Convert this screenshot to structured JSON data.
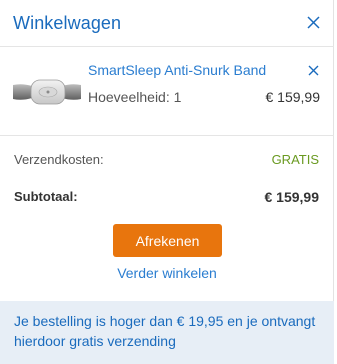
{
  "header": {
    "title": "Winkelwagen"
  },
  "item": {
    "name": "SmartSleep Anti-Snurk Band",
    "quantity": "Hoeveelheid: 1",
    "price": "€ 159,99"
  },
  "summary": {
    "shipping_label": "Verzendkosten:",
    "shipping_value": "GRATIS",
    "subtotal_label": "Subtotaal:",
    "subtotal_value": "€ 159,99"
  },
  "actions": {
    "checkout_label": "Afrekenen",
    "continue_label": "Verder winkelen"
  },
  "notice": {
    "text": "Je bestelling is hoger dan € 19,95 en je ontvangt hierdoor gratis verzending"
  },
  "colors": {
    "brand_blue": "#1a6bbd",
    "link_blue": "#2a7dd0",
    "checkout_orange": "#e8750d",
    "free_green": "#6a9a21",
    "notice_bg": "#e7eef6"
  },
  "icons": {
    "close": "close-icon",
    "remove": "remove-icon"
  }
}
